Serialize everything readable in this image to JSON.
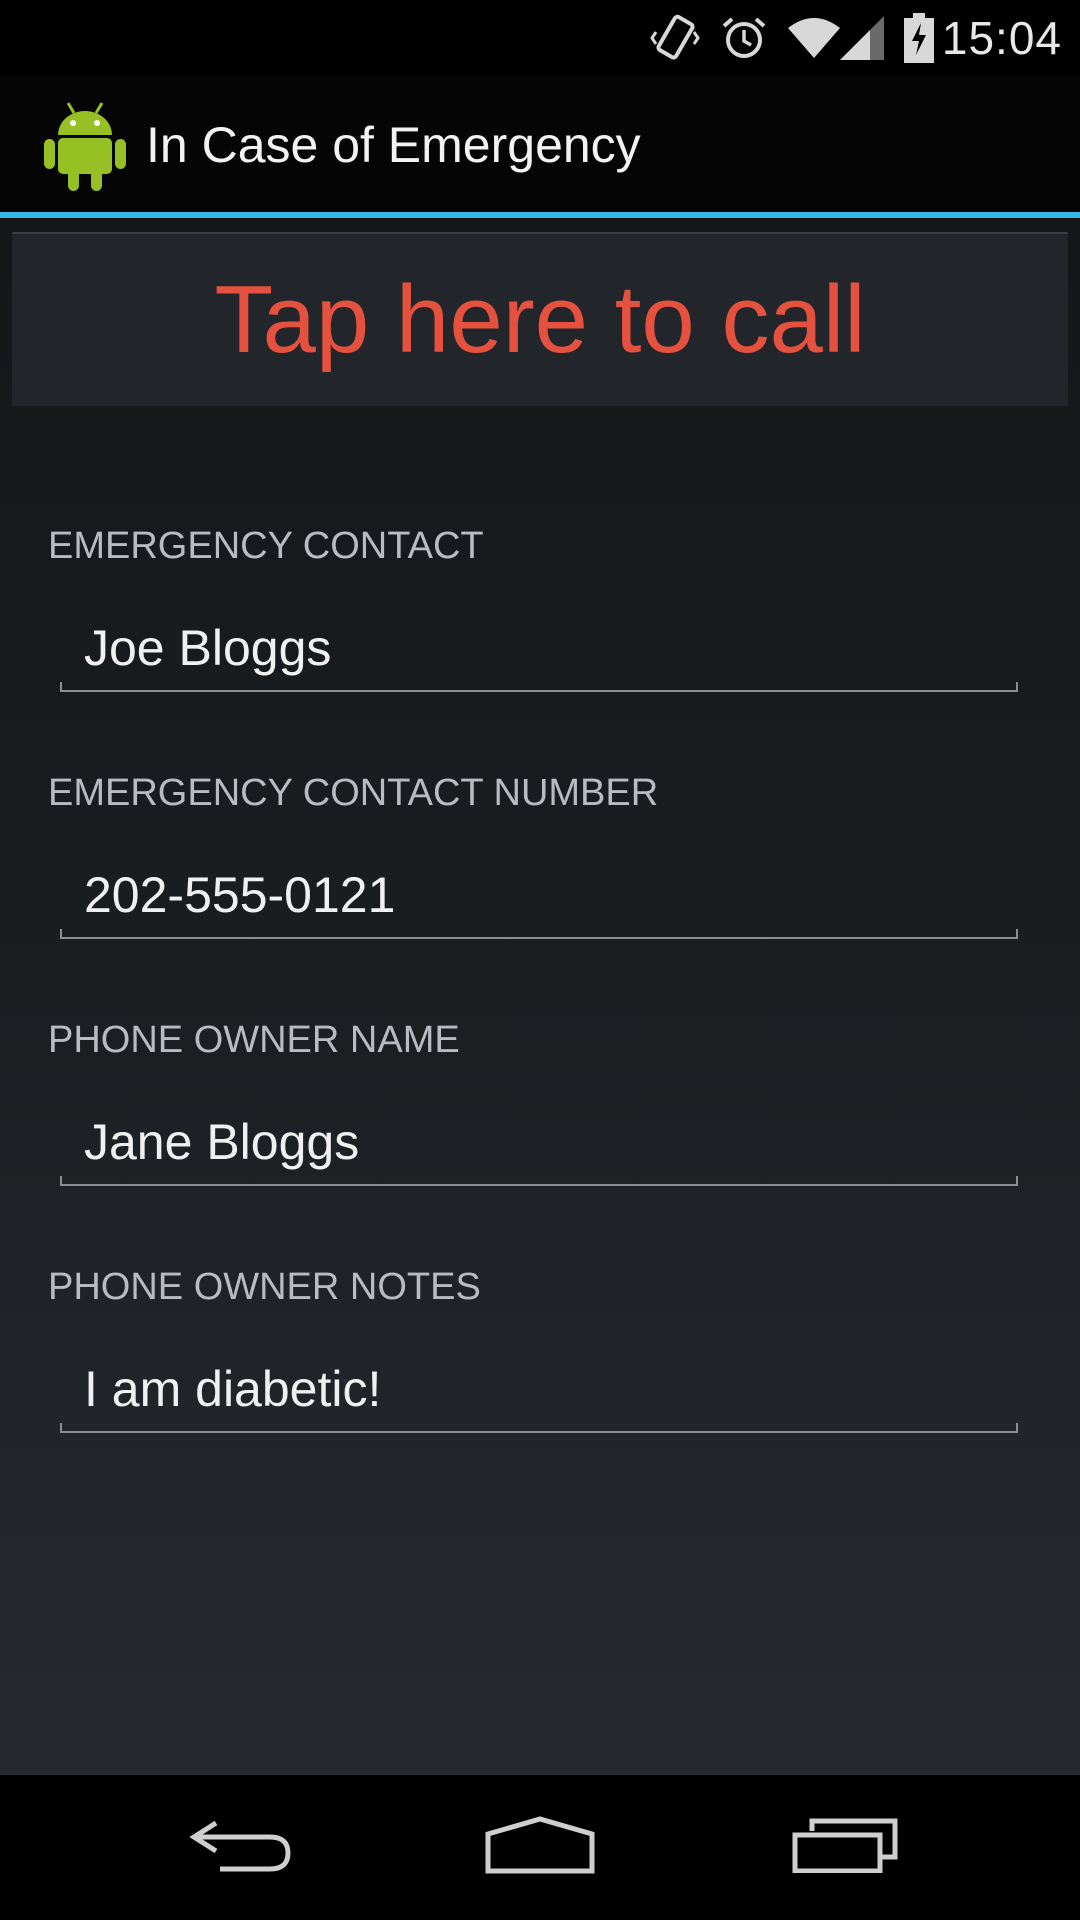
{
  "status_bar": {
    "time": "15:04",
    "icons": [
      "vibrate-icon",
      "alarm-icon",
      "wifi-icon",
      "signal-icon",
      "battery-charging-icon"
    ]
  },
  "action_bar": {
    "app_icon": "android-robot-icon",
    "title": "In Case of Emergency",
    "accent_color": "#33b5e5"
  },
  "call_button": {
    "label": "Tap here to call",
    "color": "#e5513f"
  },
  "fields": [
    {
      "label": "EMERGENCY CONTACT",
      "value": "Joe Bloggs"
    },
    {
      "label": "EMERGENCY CONTACT NUMBER",
      "value": "202-555-0121"
    },
    {
      "label": "PHONE OWNER NAME",
      "value": "Jane Bloggs"
    },
    {
      "label": "PHONE OWNER NOTES",
      "value": "I am diabetic!"
    }
  ],
  "nav_bar": {
    "icons": [
      "back-icon",
      "home-icon",
      "recent-apps-icon"
    ]
  }
}
